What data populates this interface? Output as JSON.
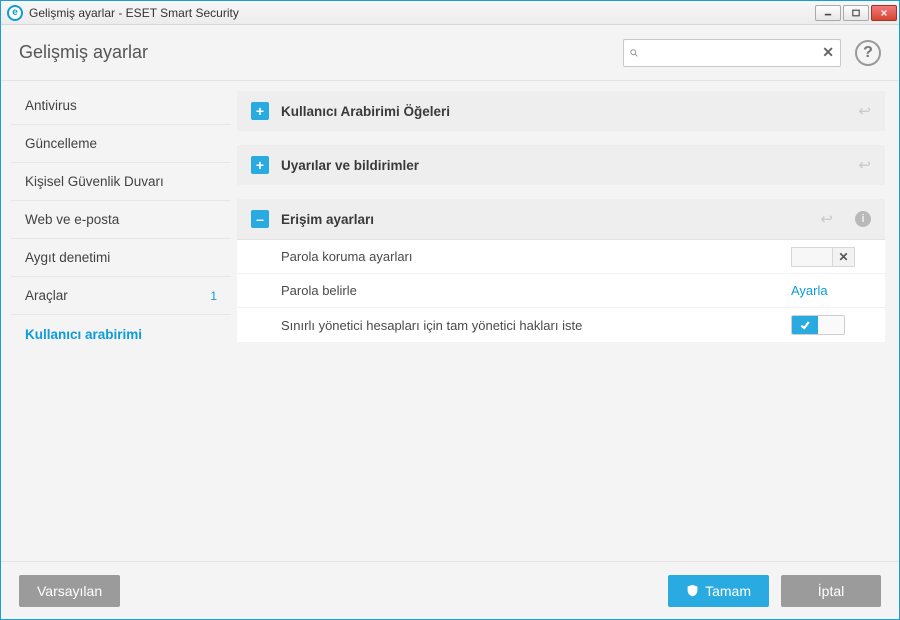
{
  "window": {
    "title": "Gelişmiş ayarlar - ESET Smart Security"
  },
  "header": {
    "title": "Gelişmiş ayarlar"
  },
  "search": {
    "value": "",
    "placeholder": ""
  },
  "sidebar": {
    "items": [
      {
        "label": "Antivirus",
        "active": false
      },
      {
        "label": "Güncelleme",
        "active": false
      },
      {
        "label": "Kişisel Güvenlik Duvarı",
        "active": false
      },
      {
        "label": "Web ve e-posta",
        "active": false
      },
      {
        "label": "Aygıt denetimi",
        "active": false
      },
      {
        "label": "Araçlar",
        "active": false,
        "badge": "1"
      },
      {
        "label": "Kullanıcı arabirimi",
        "active": true
      }
    ]
  },
  "panels": {
    "ui_elements": {
      "title": "Kullanıcı Arabirimi Öğeleri"
    },
    "alerts": {
      "title": "Uyarılar ve bildirimler"
    },
    "access": {
      "title": "Erişim ayarları",
      "rows": {
        "pwd_protect": {
          "label": "Parola koruma ayarları",
          "value": ""
        },
        "set_pwd": {
          "label": "Parola belirle",
          "link": "Ayarla"
        },
        "admin_rights": {
          "label": "Sınırlı yönetici hesapları için tam yönetici hakları iste",
          "on": true
        }
      }
    }
  },
  "footer": {
    "default": "Varsayılan",
    "ok": "Tamam",
    "cancel": "İptal"
  }
}
